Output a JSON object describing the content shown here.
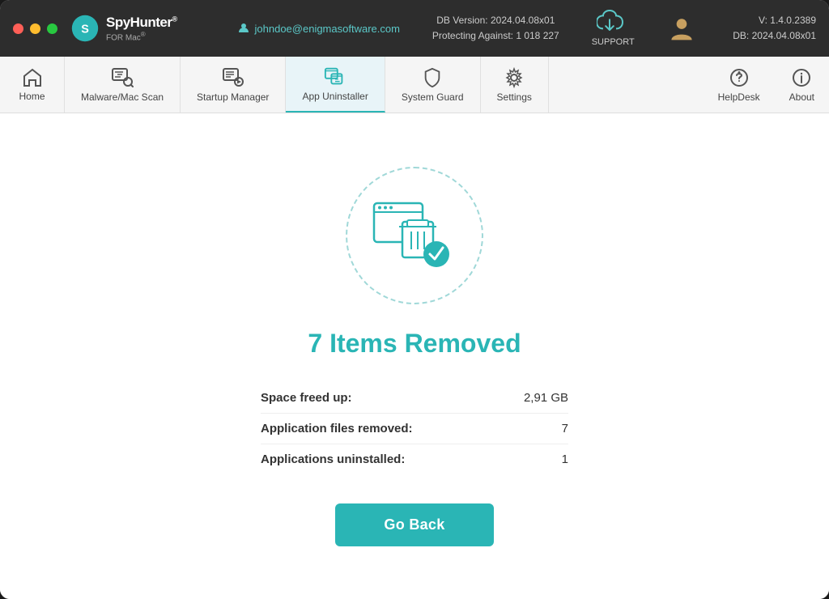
{
  "window": {
    "title": "SpyHunter for Mac"
  },
  "titlebar": {
    "logo_text": "SpyHunter",
    "logo_subtext": "FOR Mac",
    "user_email": "johndoe@enigmasoftware.com",
    "db_version_label": "DB Version:",
    "db_version": "2024.04.08x01",
    "protecting_label": "Protecting Against:",
    "protecting_count": "1 018 227",
    "support_label": "SUPPORT",
    "version_label": "V:",
    "version": "1.4.0.2389",
    "db_label": "DB:",
    "db": "2024.04.08x01"
  },
  "navbar": {
    "items": [
      {
        "id": "home",
        "label": "Home",
        "icon": "home"
      },
      {
        "id": "malware-scan",
        "label": "Malware/Mac Scan",
        "icon": "scan"
      },
      {
        "id": "startup-manager",
        "label": "Startup Manager",
        "icon": "startup"
      },
      {
        "id": "app-uninstaller",
        "label": "App Uninstaller",
        "icon": "uninstall",
        "active": true
      },
      {
        "id": "system-guard",
        "label": "System Guard",
        "icon": "shield"
      },
      {
        "id": "settings",
        "label": "Settings",
        "icon": "gear"
      }
    ],
    "right_items": [
      {
        "id": "helpdesk",
        "label": "HelpDesk",
        "icon": "helpdesk"
      },
      {
        "id": "about",
        "label": "About",
        "icon": "info"
      }
    ]
  },
  "main": {
    "result_title": "7 Items Removed",
    "stats": [
      {
        "label": "Space freed up:",
        "value": "2,91 GB"
      },
      {
        "label": "Application files removed:",
        "value": "7"
      },
      {
        "label": "Applications uninstalled:",
        "value": "1"
      }
    ],
    "go_back_label": "Go Back"
  }
}
